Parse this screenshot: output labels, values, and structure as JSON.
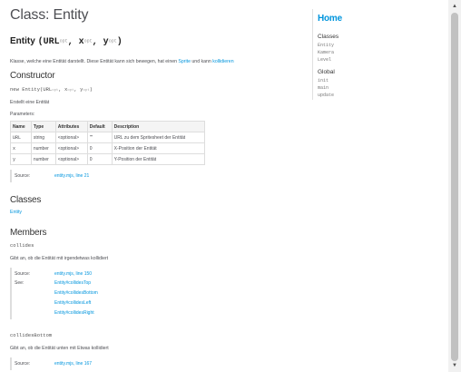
{
  "page": {
    "title": "Class: Entity",
    "signature": {
      "name": "Entity",
      "params": [
        {
          "name": "URL",
          "opt": "opt"
        },
        {
          "name": "x",
          "opt": "opt"
        },
        {
          "name": "y",
          "opt": "opt"
        }
      ]
    },
    "description": {
      "pre": "Klasse, welche eine Entität darstellt. Diese Entität kann sich bewegen, hat einen ",
      "link1": "Sprite",
      "mid": " und kann ",
      "link2": "kollidieren"
    }
  },
  "constructor": {
    "heading": "Constructor",
    "signature": {
      "prefix": "new Entity(",
      "p1": "URL",
      "p2": "x",
      "p3": "y",
      "opt": "opt",
      "suffix": ")"
    },
    "description": "Erstellt eine Entität",
    "params_label": "Parameters:",
    "table": {
      "headers": [
        "Name",
        "Type",
        "Attributes",
        "Default",
        "Description"
      ],
      "rows": [
        [
          "URL",
          "string",
          "<optional>",
          "\"\"",
          "URL zu dem Spritesheet der Entität"
        ],
        [
          "x",
          "number",
          "<optional>",
          "0",
          "X-Position der Entität"
        ],
        [
          "y",
          "number",
          "<optional>",
          "0",
          "Y-Position der Entität"
        ]
      ]
    },
    "source_label": "Source:",
    "source_link": "entity.mjs, line 21"
  },
  "classes": {
    "heading": "Classes",
    "link": "Entity"
  },
  "members": {
    "heading": "Members",
    "items": [
      {
        "name": "collides",
        "description": "Gibt an, ob die Entität mit irgendetwas kollidiert",
        "source_label": "Source:",
        "source_link": "entity.mjs, line 150",
        "see_label": "See:",
        "see": [
          "Entity#collidesTop",
          "Entity#collidesBottom",
          "Entity#collidesLeft",
          "Entity#collidesRight"
        ]
      },
      {
        "name": "collidesBottom",
        "description": "Gibt an, ob die Entität unten mit Etwas kollidiert",
        "source_label": "Source:",
        "source_link": "entity.mjs, line 167"
      }
    ]
  },
  "nav": {
    "home": "Home",
    "classes_heading": "Classes",
    "classes": [
      "Entity",
      "Kamera",
      "Level"
    ],
    "global_heading": "Global",
    "global": [
      "init",
      "main",
      "update"
    ]
  },
  "scrollbar": {
    "up_icon": "triangle-up",
    "down_icon": "triangle-down",
    "colors": {
      "track": "#f1f1f1",
      "thumb": "#c1c1c1"
    }
  }
}
